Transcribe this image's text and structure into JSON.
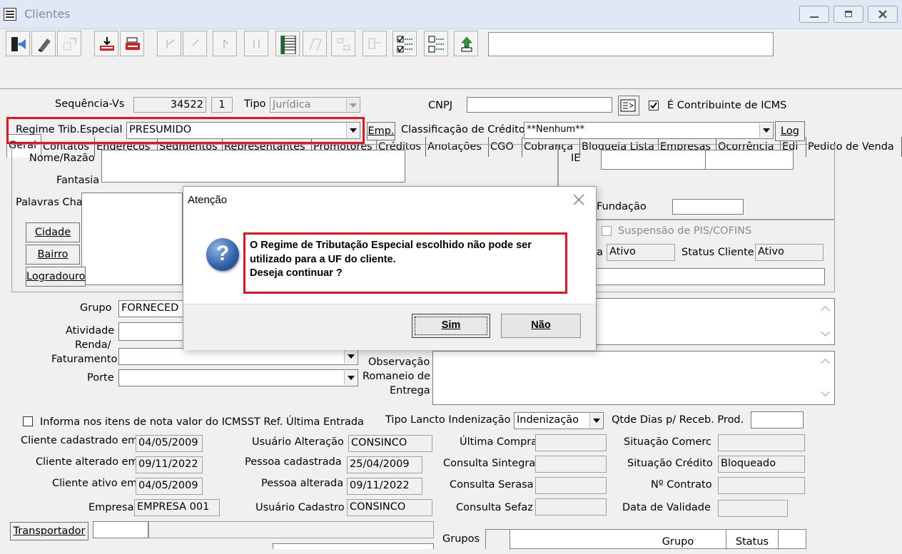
{
  "window": {
    "title": "Clientes"
  },
  "toolbar": {
    "search_value": ""
  },
  "tabs": [
    "Geral",
    "Contatos",
    "Endereços",
    "Segmentos",
    "Representantes",
    "Promotores",
    "Créditos",
    "Anotações",
    "CGO",
    "Cobrança",
    "Bloqueia Lista",
    "Empresas",
    "Ocorrência",
    "Edi",
    "Pedido de Venda"
  ],
  "form": {
    "sequencia_label": "Sequência-Vs",
    "sequencia_value": "34522",
    "sequencia_digit": "1",
    "tipo_label": "Tipo",
    "tipo_value": "Jurídica",
    "cnpj_label": "CNPJ",
    "cnpj_value": "",
    "contribuinte_label": "É Contribuinte de ICMS",
    "regime_label": "Regime Trib.Especial",
    "regime_value": "PRESUMIDO",
    "emp_button": "Emp.",
    "classificacao_label": "Classificação de Crédito",
    "classificacao_value": "**Nenhum**",
    "log_button": "Log",
    "nome_label": "Nome/Razão",
    "fantasia_label": "Fantasia",
    "ie_label": "IE",
    "palavras_label": "Palavras Chave",
    "fundacao_label": "Fundação",
    "cidade_button": "Cidade",
    "bairro_button": "Bairro",
    "logradouro_button": "Logradouro",
    "suspensao_label": "Suspensão de PIS/COFINS",
    "status_a_suffix": "a",
    "status_a_value": "Ativo",
    "status_cliente_label": "Status Cliente",
    "status_cliente_value": "Ativo",
    "grupo_label": "Grupo",
    "grupo_value": "FORNECED",
    "atividade_label": "Atividade",
    "renda_label_1": "Renda/",
    "renda_label_2": "Faturamento",
    "porte_label": "Porte",
    "obs_label_1": "Observação",
    "obs_label_2": "Romaneio de",
    "obs_label_3": "Entrega",
    "informa_label": "Informa nos itens de nota valor do ICMSST Ref. Última Entrada",
    "tipo_lancto_label": "Tipo Lancto Indenização",
    "tipo_lancto_value": "Indenização",
    "qtde_dias_label": "Qtde Dias p/ Receb. Prod.",
    "cliente_cadastrado_label": "Cliente cadastrado em",
    "cliente_cadastrado_value": "04/05/2009",
    "usuario_alteracao_label": "Usuário Alteração",
    "usuario_alteracao_value": "CONSINCO",
    "ultima_compra_label": "Última Compra",
    "situacao_comerc_label": "Situação Comerc",
    "cliente_alterado_label": "Cliente alterado em",
    "cliente_alterado_value": "09/11/2022",
    "pessoa_cadastrada_label": "Pessoa cadastrada",
    "pessoa_cadastrada_value": "25/04/2009",
    "consulta_sintegra_label": "Consulta Sintegra",
    "situacao_credito_label": "Situação Crédito",
    "situacao_credito_value": "Bloqueado",
    "cliente_ativo_label": "Cliente ativo em",
    "cliente_ativo_value": "04/05/2009",
    "pessoa_alterada_label": "Pessoa alterada",
    "pessoa_alterada_value": "09/11/2022",
    "consulta_serasa_label": "Consulta Serasa",
    "contrato_label": "Nº Contrato",
    "empresa_label": "Empresa",
    "empresa_value": "EMPRESA 001",
    "usuario_cadastro_label": "Usuário Cadastro",
    "usuario_cadastro_value": "CONSINCO",
    "consulta_sefaz_label": "Consulta Sefaz",
    "data_validade_label": "Data de Validade",
    "transportador_button": "Transportador",
    "grupos_label": "Grupos",
    "grupos_columns": [
      "Grupo",
      "Status"
    ]
  },
  "dialog": {
    "title": "Atenção",
    "message_line1": "O Regime de Tributação Especial escolhido não pode ser",
    "message_line2": "utilizado para a UF do cliente.",
    "message_line3": "Deseja continuar ?",
    "yes_button": "Sim",
    "no_button": "Não"
  },
  "colors": {
    "highlight": "#e8141b",
    "question_icon": "#2f5fa8"
  }
}
